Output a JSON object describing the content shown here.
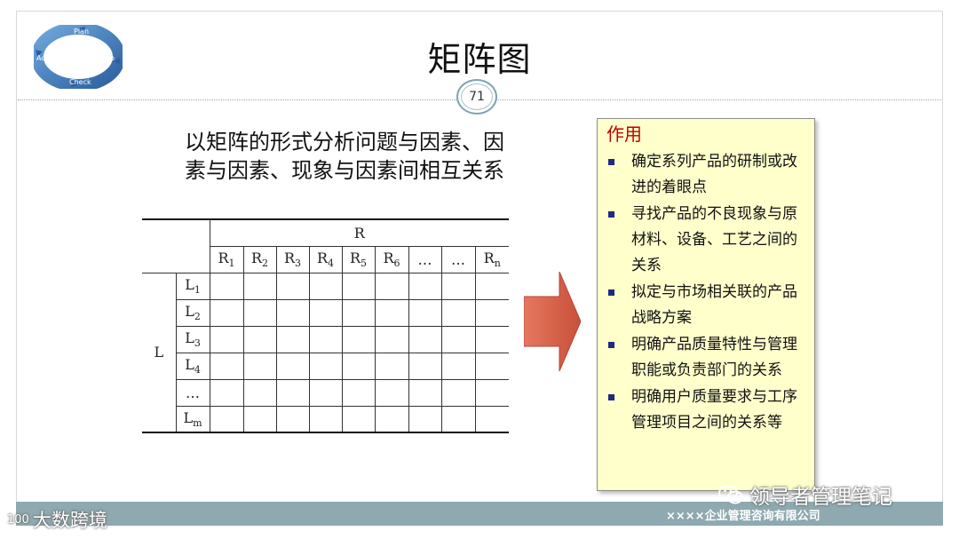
{
  "slide": {
    "title": "矩阵图",
    "page_number": "71",
    "subtitle_line1": "以矩阵的形式分析问题与因素、因",
    "subtitle_line2": "素与因素、现象与因素间相互关系"
  },
  "logo": {
    "labels": [
      "Plan",
      "Do",
      "Check",
      "Act"
    ]
  },
  "matrix": {
    "top_header": "R",
    "row_header": "L",
    "col_headers": [
      {
        "base": "R",
        "sub": "1"
      },
      {
        "base": "R",
        "sub": "2"
      },
      {
        "base": "R",
        "sub": "3"
      },
      {
        "base": "R",
        "sub": "4"
      },
      {
        "base": "R",
        "sub": "5"
      },
      {
        "base": "R",
        "sub": "6"
      },
      {
        "base": "…",
        "sub": ""
      },
      {
        "base": "…",
        "sub": ""
      },
      {
        "base": "R",
        "sub": "n"
      }
    ],
    "row_labels": [
      {
        "base": "L",
        "sub": "1"
      },
      {
        "base": "L",
        "sub": "2"
      },
      {
        "base": "L",
        "sub": "3"
      },
      {
        "base": "L",
        "sub": "4"
      },
      {
        "base": "…",
        "sub": ""
      },
      {
        "base": "L",
        "sub": "m"
      }
    ]
  },
  "panel": {
    "title": "作用",
    "items": [
      "确定系列产品的研制或改进的着眼点",
      "寻找产品的不良现象与原材料、设备、工艺之间的关系",
      "拟定与市场相关联的产品战略方案",
      "明确产品质量特性与管理职能或负责部门的关系",
      "明确用户质量要求与工序管理项目之间的关系等"
    ]
  },
  "footer": {
    "company": "××××企业管理咨询有限公司"
  },
  "watermarks": {
    "left": "大数跨境",
    "left_badge": "100",
    "right": "领导者管理笔记"
  },
  "colors": {
    "arrow": "#d9614a",
    "panel_bg": "#ffffcc",
    "footer_bar": "#8ea9af",
    "panel_title": "#c00000"
  }
}
